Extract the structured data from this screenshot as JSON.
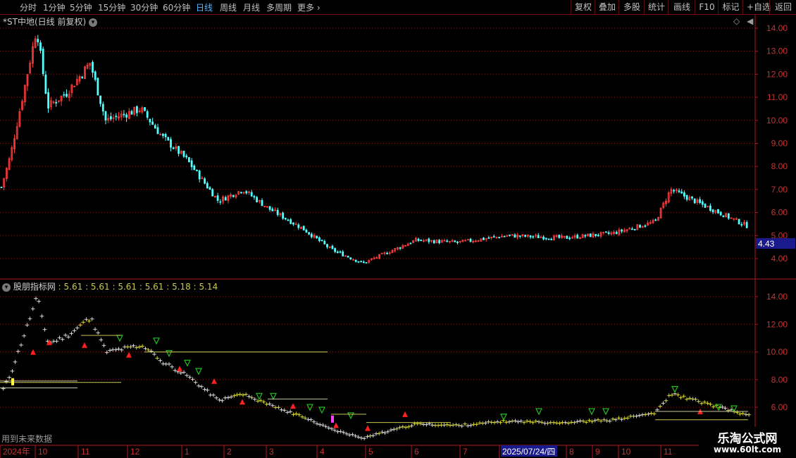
{
  "toolbar": {
    "periods": [
      {
        "label": "分时",
        "active": false
      },
      {
        "label": "1分钟",
        "active": false
      },
      {
        "label": "5分钟",
        "active": false
      },
      {
        "label": "15分钟",
        "active": false
      },
      {
        "label": "30分钟",
        "active": false
      },
      {
        "label": "60分钟",
        "active": false
      },
      {
        "label": "日线",
        "active": true
      },
      {
        "label": "周线",
        "active": false
      },
      {
        "label": "月线",
        "active": false
      },
      {
        "label": "多周期",
        "active": false
      },
      {
        "label": "更多",
        "active": false
      }
    ],
    "right_buttons": [
      "复权",
      "叠加",
      "多股",
      "统计",
      "画线",
      "F10",
      "标记",
      "+自选",
      "返回"
    ]
  },
  "main_chart": {
    "title": "*ST中地(日线 前复权)",
    "y_ticks": [
      "14.00",
      "13.00",
      "12.00",
      "11.00",
      "10.00",
      "9.00",
      "8.00",
      "7.00",
      "6.00",
      "5.00",
      "4.00"
    ],
    "current_price_tag": "4.43",
    "colors": {
      "up": "#ff3c3c",
      "down": "#54ffff",
      "grid": "#8b1a1a",
      "axis": "#b0191e",
      "tag_bg": "#1a1a8c"
    }
  },
  "indicator": {
    "name": "股朋指标网",
    "values": "5.61 : 5.61 : 5.61 : 5.61 : 5.18 : 5.14",
    "y_ticks": [
      "14.00",
      "12.00",
      "10.00",
      "8.00",
      "6.00"
    ],
    "future_data_note": "用到未来数据",
    "colors": {
      "dot_white": "#ffffff",
      "dot_yellow": "#ffff40",
      "buy_marker": "#ff2020",
      "sell_marker": "#20c020",
      "purple_bar": "#ff40ff"
    }
  },
  "x_axis": {
    "labels": [
      "2024年",
      "10",
      "11",
      "12",
      "1",
      "2",
      "3",
      "4",
      "5",
      "6",
      "7",
      "2025/07/24/四",
      "8",
      "9",
      "10",
      "11"
    ],
    "highlight_label": "2025/07/24/四"
  },
  "chart_data": {
    "type": "candlestick",
    "title": "*ST中地(日线 前复权)",
    "ylim": [
      3.5,
      14.5
    ],
    "close_path": [
      {
        "x": "2024-09",
        "y": 7.1
      },
      {
        "x": "2024-09 mid",
        "y": 8.5
      },
      {
        "x": "2024-10 start",
        "y": 12.2
      },
      {
        "x": "2024-10 peak",
        "y": 14.0
      },
      {
        "x": "2024-10 mid",
        "y": 10.6
      },
      {
        "x": "2024-11 start",
        "y": 11.2
      },
      {
        "x": "2024-11 peak",
        "y": 12.5
      },
      {
        "x": "2024-11 end",
        "y": 10.0
      },
      {
        "x": "2024-12",
        "y": 10.5
      },
      {
        "x": "2024-12 end",
        "y": 9.3
      },
      {
        "x": "2025-01",
        "y": 8.3
      },
      {
        "x": "2025-02",
        "y": 6.5
      },
      {
        "x": "2025-03",
        "y": 7.0
      },
      {
        "x": "2025-03 end",
        "y": 6.2
      },
      {
        "x": "2025-04",
        "y": 5.3
      },
      {
        "x": "2025-04 end",
        "y": 4.4
      },
      {
        "x": "2025-05",
        "y": 3.8
      },
      {
        "x": "2025-06",
        "y": 4.8
      },
      {
        "x": "2025-07",
        "y": 4.7
      },
      {
        "x": "2025-08",
        "y": 5.0
      },
      {
        "x": "2025-09",
        "y": 4.9
      },
      {
        "x": "2025-10",
        "y": 5.1
      },
      {
        "x": "2025-10 end",
        "y": 5.6
      },
      {
        "x": "2025-11 peak",
        "y": 7.0
      },
      {
        "x": "2025-11 end",
        "y": 5.4
      }
    ],
    "indicator_values": [
      5.61,
      5.61,
      5.61,
      5.61,
      5.18,
      5.14
    ]
  }
}
